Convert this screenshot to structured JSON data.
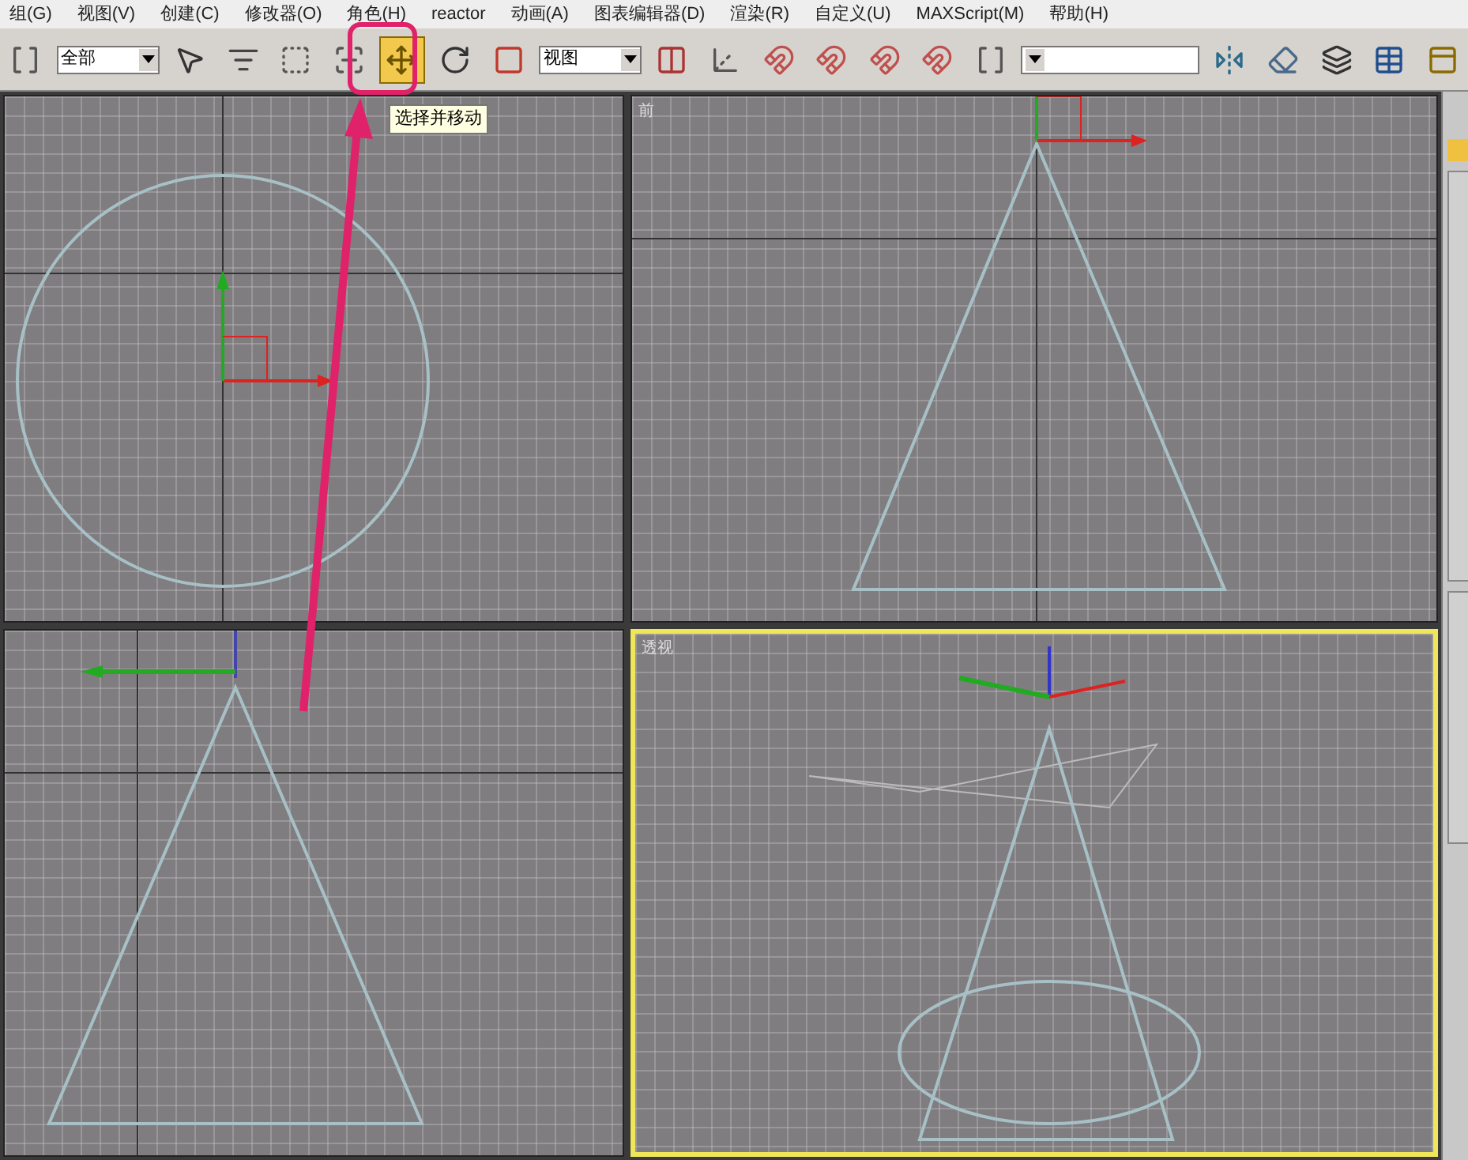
{
  "menu_bar": [
    "组(G)",
    "视图(V)",
    "创建(C)",
    "修改器(O)",
    "角色(H)",
    "reactor",
    "动画(A)",
    "图表编辑器(D)",
    "渲染(R)",
    "自定义(U)",
    "MAXScript(M)",
    "帮助(H)"
  ],
  "toolbar": [
    {
      "kind": "tool",
      "selected": false
    },
    {
      "kind": "dropdown",
      "value": "全部"
    },
    {
      "kind": "tool",
      "selected": false
    },
    {
      "kind": "tool",
      "selected": false
    },
    {
      "kind": "tool",
      "selected": false
    },
    {
      "kind": "tool",
      "selected": false
    },
    {
      "kind": "tool",
      "selected": true
    },
    {
      "kind": "tool",
      "selected": false
    },
    {
      "kind": "tool",
      "selected": false
    },
    {
      "kind": "dropdown",
      "value": "视图"
    },
    {
      "kind": "tool",
      "selected": false
    },
    {
      "kind": "tool",
      "selected": false
    },
    {
      "kind": "tool",
      "selected": false
    },
    {
      "kind": "tool",
      "selected": false
    },
    {
      "kind": "tool",
      "selected": false
    },
    {
      "kind": "tool",
      "selected": false
    },
    {
      "kind": "tool",
      "selected": false
    },
    {
      "kind": "dropdown"
    },
    {
      "kind": "tool",
      "selected": false
    },
    {
      "kind": "tool",
      "selected": false
    },
    {
      "kind": "tool",
      "selected": false
    },
    {
      "kind": "tool",
      "selected": false
    },
    {
      "kind": "tool",
      "selected": false
    }
  ],
  "tooltip": "选择并移动",
  "viewports": [
    {
      "kind": "top",
      "active": false
    },
    {
      "kind": "front",
      "label": "前",
      "active": false
    },
    {
      "kind": "left",
      "active": false
    },
    {
      "kind": "perspective",
      "label": "透视",
      "active": true
    }
  ]
}
